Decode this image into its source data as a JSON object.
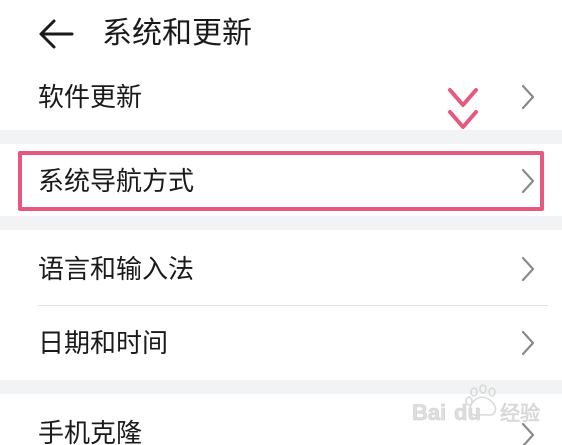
{
  "header": {
    "title": "系统和更新",
    "back_icon": "arrow-left-icon"
  },
  "items": [
    {
      "label": "软件更新"
    },
    {
      "label": "系统导航方式"
    },
    {
      "label": "语言和输入法"
    },
    {
      "label": "日期和时间"
    },
    {
      "label": "手机克隆"
    }
  ],
  "annotation": {
    "highlight_color": "#e8577e",
    "marker_icon": "double-chevron-down-icon"
  },
  "watermark": {
    "text": "Baidu经验"
  }
}
